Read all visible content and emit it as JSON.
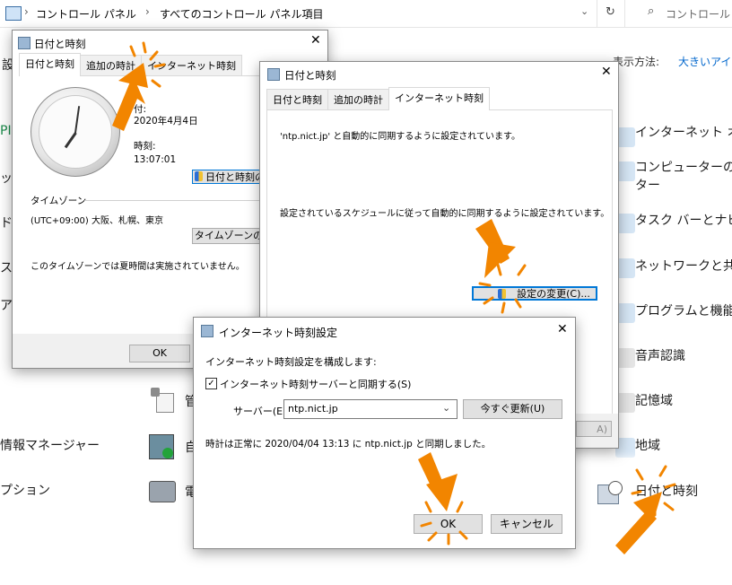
{
  "addressbar": {
    "breadcrumb_1": "コントロール パネル",
    "breadcrumb_2": "すべてのコントロール パネル項目",
    "search_placeholder": "コントロール パネ"
  },
  "view_options": {
    "label": "表示方法:",
    "value": "大きいアイコ"
  },
  "control_panel": {
    "right_items": [
      "インターネット オプ",
      "コンピューターの簡",
      "ター",
      "タスク バーとナビゲ",
      "ネットワークと共有",
      "プログラムと機能",
      "音声認識",
      "記憶域",
      "地域",
      "日付と時刻"
    ],
    "left_items": [
      "情報マネージャー",
      "プション"
    ],
    "left_edge_fragments": [
      "設",
      "PI",
      "ック",
      "ド",
      "ス",
      "ア"
    ],
    "mid_fragments": [
      "管",
      "自",
      "電"
    ]
  },
  "win1": {
    "title": "日付と時刻",
    "tabs": [
      "日付と時刻",
      "追加の時計",
      "インターネット時刻"
    ],
    "date_label": "付:",
    "date_value": "2020年4月4日",
    "time_label": "時刻:",
    "time_value": "13:07:01",
    "change_datetime_button": "日付と時刻の",
    "timezone_heading": "タイムゾーン",
    "timezone_value": "(UTC+09:00) 大阪、札幌、東京",
    "change_timezone_button": "タイムゾーンの",
    "dst_note": "このタイムゾーンでは夏時間は実施されていません。",
    "ok_button": "OK"
  },
  "win2": {
    "title": "日付と時刻",
    "tabs": [
      "日付と時刻",
      "追加の時計",
      "インターネット時刻"
    ],
    "sync_text": "'ntp.nict.jp' と自動的に同期するように設定されています。",
    "schedule_text": "設定されているスケジュールに従って自動的に同期するように設定されています。",
    "change_settings_button": "設定の変更(C)...",
    "apply_fragment": "A)"
  },
  "dialog": {
    "title": "インターネット時刻設定",
    "heading": "インターネット時刻設定を構成します:",
    "checkbox_label": "インターネット時刻サーバーと同期する(S)",
    "checkbox_checked": true,
    "server_label": "サーバー(E):",
    "server_value": "ntp.nict.jp",
    "update_now_button": "今すぐ更新(U)",
    "status_text": "時計は正常に 2020/04/04 13:13 に ntp.nict.jp と同期しました。",
    "ok_button": "OK",
    "cancel_button": "キャンセル"
  },
  "colors": {
    "annotation_orange": "#f28500",
    "link_blue": "#0066cc",
    "focus_blue": "#0078d7"
  }
}
